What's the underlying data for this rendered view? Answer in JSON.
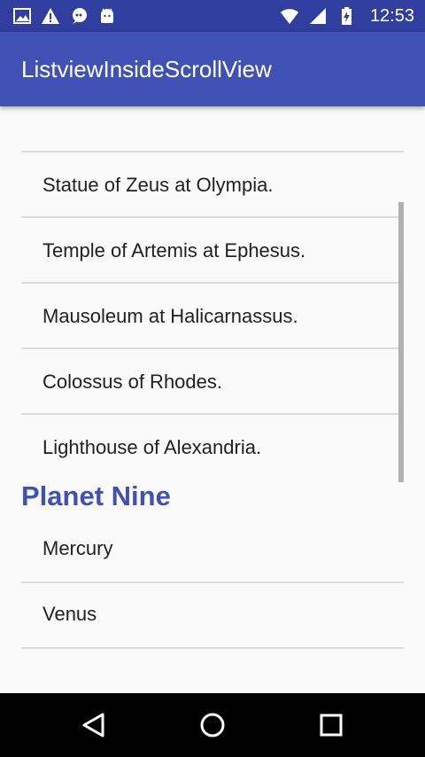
{
  "status_bar": {
    "time": "12:53",
    "left_icons": [
      "image-icon",
      "warning-icon",
      "chat-icon",
      "android-icon"
    ],
    "right_icons": [
      "wifi-icon",
      "signal-icon",
      "battery-charging-icon"
    ]
  },
  "app_bar": {
    "title": "ListviewInsideScrollView"
  },
  "list_top": {
    "items": [
      "Statue of Zeus at Olympia.",
      "Temple of Artemis at Ephesus.",
      "Mausoleum at Halicarnassus.",
      "Colossus of Rhodes.",
      "Lighthouse of Alexandria."
    ]
  },
  "section": {
    "title": "Planet Nine"
  },
  "list_planets": {
    "items": [
      "Mercury",
      "Venus"
    ]
  },
  "nav_bar": {
    "icons": [
      "back-icon",
      "home-icon",
      "recents-icon"
    ]
  },
  "colors": {
    "primary": "#3f51b5",
    "primary_dark": "#303f9f",
    "divider": "#dcdcdc",
    "text": "#212121",
    "background": "#fafafa"
  }
}
